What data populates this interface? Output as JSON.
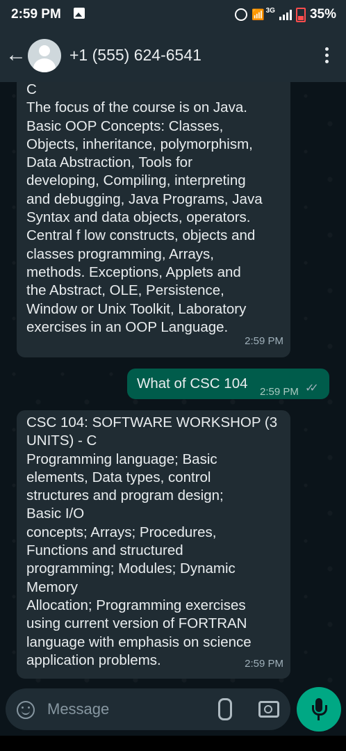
{
  "status_bar": {
    "time": "2:59 PM",
    "network": "3G",
    "battery": "35%",
    "icons": [
      "gallery-icon",
      "alarm-icon",
      "wifi-icon",
      "signal-icon",
      "battery-icon"
    ]
  },
  "header": {
    "contact": "+1 (555) 624-6541",
    "icons": [
      "back-arrow-icon",
      "avatar",
      "more-options-icon"
    ]
  },
  "messages": [
    {
      "direction": "incoming",
      "text": "C\nThe focus of the course is on Java.\nBasic OOP Concepts: Classes,\nObjects, inheritance, polymorphism,\nData Abstraction, Tools for\ndeveloping, Compiling, interpreting\nand debugging, Java Programs, Java\nSyntax and data objects, operators.\nCentral f low constructs, objects and\nclasses programming, Arrays,\nmethods. Exceptions, Applets and\nthe Abstract, OLE, Persistence,\nWindow or Unix Toolkit, Laboratory\nexercises in an OOP Language.",
      "time": "2:59 PM"
    },
    {
      "direction": "outgoing",
      "text": "What of CSC 104",
      "time": "2:59 PM",
      "status": "read"
    },
    {
      "direction": "incoming",
      "text": "CSC 104: SOFTWARE WORKSHOP (3\nUNITS) - C\nProgramming language; Basic\nelements, Data types, control\nstructures and program design;\nBasic I/O\nconcepts; Arrays; Procedures,\nFunctions and structured\nprogramming; Modules; Dynamic\nMemory\nAllocation; Programming exercises\nusing current version of FORTRAN\nlanguage with emphasis on science\napplication problems.",
      "time": "2:59 PM"
    }
  ],
  "composer": {
    "placeholder": "Message",
    "icons": [
      "emoji-icon",
      "attach-icon",
      "camera-icon",
      "mic-icon"
    ]
  },
  "colors": {
    "background": "#0b141a",
    "bar": "#1f2c34",
    "incoming_bubble": "#202c33",
    "outgoing_bubble": "#005c4b",
    "accent": "#00a884",
    "read_ticks": "#9fb0ba"
  }
}
